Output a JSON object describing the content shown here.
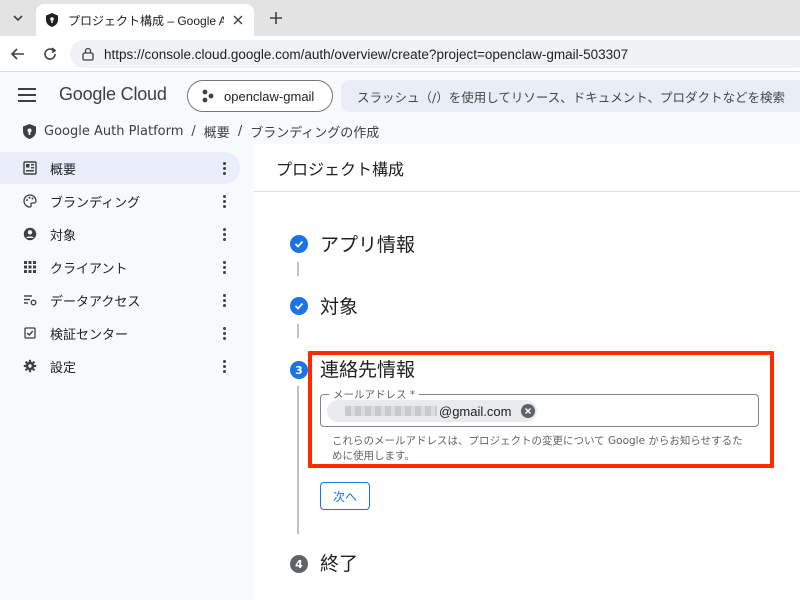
{
  "browser": {
    "tab_title": "プロジェクト構成 – Google Auth Platf",
    "url": "https://console.cloud.google.com/auth/overview/create?project=openclaw-gmail-503307"
  },
  "header": {
    "brand": "Google Cloud",
    "project": "openclaw-gmail",
    "search_placeholder": "スラッシュ（/）を使用してリソース、ドキュメント、プロダクトなどを検索"
  },
  "breadcrumb": [
    "Google Auth Platform",
    "概要",
    "ブランディングの作成"
  ],
  "sidebar": {
    "items": [
      {
        "label": "概要",
        "icon": "dashboard-icon",
        "active": true
      },
      {
        "label": "ブランディング",
        "icon": "palette-icon",
        "active": false
      },
      {
        "label": "対象",
        "icon": "account-circle-icon",
        "active": false
      },
      {
        "label": "クライアント",
        "icon": "apps-grid-icon",
        "active": false
      },
      {
        "label": "データアクセス",
        "icon": "data-access-icon",
        "active": false
      },
      {
        "label": "検証センター",
        "icon": "verified-check-icon",
        "active": false
      },
      {
        "label": "設定",
        "icon": "gear-icon",
        "active": false
      }
    ]
  },
  "main": {
    "title": "プロジェクト構成",
    "steps": [
      {
        "title": "アプリ情報",
        "status": "done"
      },
      {
        "title": "対象",
        "status": "done"
      },
      {
        "title": "連絡先情報",
        "status": "current",
        "number": "3"
      },
      {
        "title": "終了",
        "status": "todo",
        "number": "4"
      }
    ],
    "email_field_label": "メールアドレス *",
    "email_chip_value": "@gmail.com",
    "help_text": "これらのメールアドレスは、プロジェクトの変更について Google からお知らせするために使用します。",
    "next_button": "次へ"
  },
  "colors": {
    "accent": "#1a73e8",
    "highlight": "#ff2a00"
  }
}
